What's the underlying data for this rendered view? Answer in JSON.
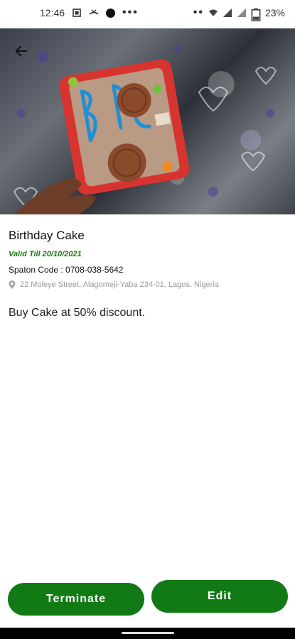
{
  "status_bar": {
    "time": "12:46",
    "battery": "23%"
  },
  "offer": {
    "title": "Birthday Cake",
    "valid_till": "Valid Till 20/10/2021",
    "spaton_code": "Spaton Code : 0708-038-5642",
    "address": "22 Moleye Street, Alagomeji-Yaba 234-01, Lagos, Nigeria",
    "description": "Buy Cake at 50% discount."
  },
  "actions": {
    "terminate_label": "Terminate",
    "edit_label": "Edit"
  },
  "colors": {
    "primary_green": "#127a15",
    "valid_green": "#1a7a14"
  }
}
